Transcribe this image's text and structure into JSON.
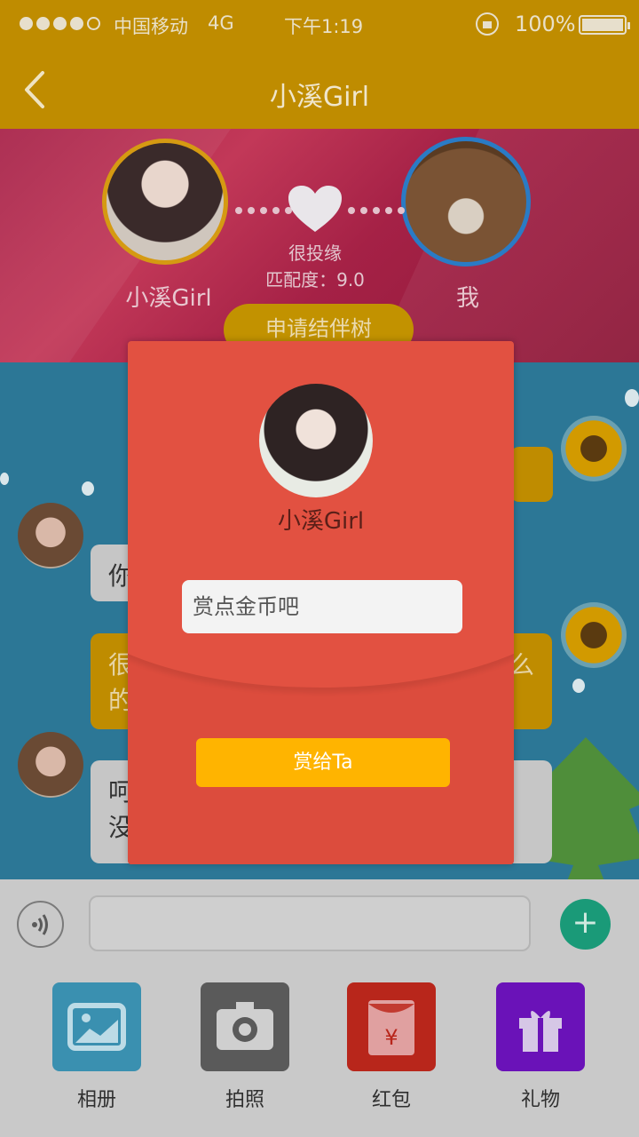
{
  "status_bar": {
    "carrier": "中国移动",
    "network": "4G",
    "time": "下午1:19",
    "battery": "100%"
  },
  "nav": {
    "title": "小溪Girl"
  },
  "match_header": {
    "left_name": "小溪Girl",
    "right_name": "我",
    "fate_text": "很投缘",
    "match_text": "匹配度：9.0",
    "apply_button": "申请结伴树"
  },
  "chat": {
    "visible_fragments": [
      "你",
      "很",
      "的",
      "么",
      "呵",
      "没"
    ]
  },
  "toolbar": {
    "items": [
      {
        "label": "相册",
        "icon": "album-icon",
        "color": "#3aa0c8"
      },
      {
        "label": "拍照",
        "icon": "camera-icon",
        "color": "#5a5a5a"
      },
      {
        "label": "红包",
        "icon": "red-envelope-icon",
        "color": "#c8261b"
      },
      {
        "label": "礼物",
        "icon": "gift-icon",
        "color": "#6b0fbf"
      }
    ]
  },
  "modal": {
    "name": "小溪Girl",
    "input_placeholder": "赏点金币吧",
    "button_label": "赏给Ta"
  },
  "colors": {
    "nav_bg": "#bf8c00",
    "modal_bg": "#e25141",
    "button_yellow": "#ffb400",
    "plus_green": "#1a9a78"
  }
}
